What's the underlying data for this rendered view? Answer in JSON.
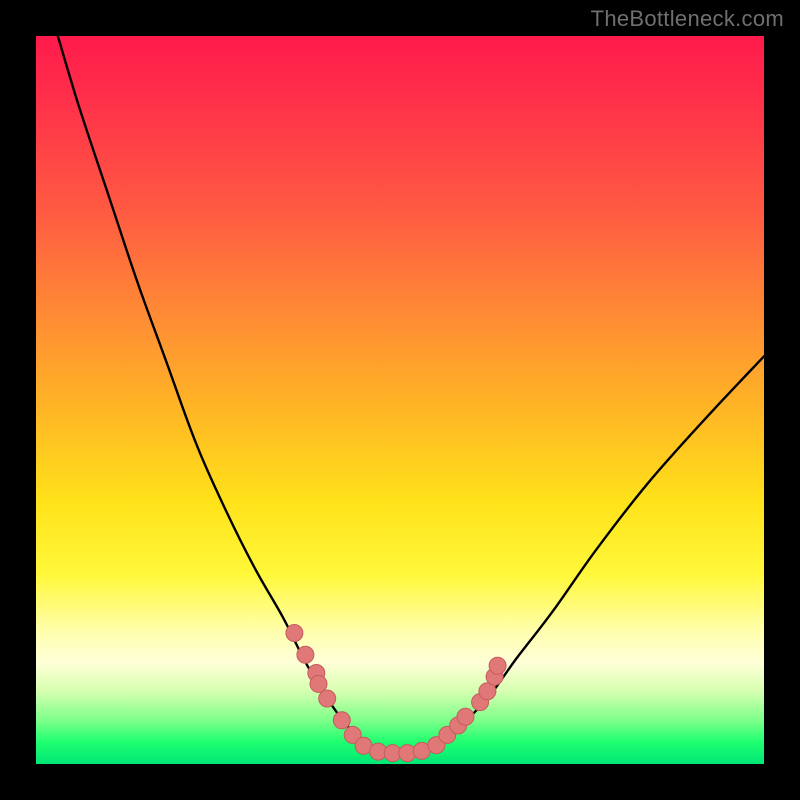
{
  "watermark": "TheBottleneck.com",
  "colors": {
    "frame": "#000000",
    "curve": "#000000",
    "dot_fill": "#e07878",
    "dot_stroke": "#c55c5c"
  },
  "chart_data": {
    "type": "line",
    "title": "",
    "xlabel": "",
    "ylabel": "",
    "xlim": [
      0,
      100
    ],
    "ylim": [
      0,
      100
    ],
    "note": "V-shaped bottleneck curve on vertical red→green gradient. Y is bottleneck severity (100=max red at top, 0=ideal green at bottom). X is component balance (GPU-limited left → CPU-limited right). Values estimated from pixel position since axes carry no tick labels.",
    "series": [
      {
        "name": "bottleneck-curve",
        "x": [
          3,
          6,
          10,
          14,
          18,
          22,
          26,
          30,
          34,
          37,
          40,
          43,
          46,
          49,
          52,
          55,
          58,
          62,
          66,
          71,
          77,
          84,
          92,
          100
        ],
        "y": [
          100,
          90,
          78,
          66,
          55,
          44,
          35,
          27,
          20,
          14,
          9,
          5,
          2.5,
          1.5,
          1.5,
          2.5,
          5,
          9,
          14.5,
          21,
          29.5,
          38.5,
          47.5,
          56
        ]
      }
    ],
    "dots": {
      "name": "sample-points",
      "x": [
        35.5,
        37,
        38.5,
        38.8,
        40,
        42,
        43.5,
        45,
        47,
        49,
        51,
        53,
        55,
        56.5,
        58,
        59,
        61,
        62,
        63,
        63.4
      ],
      "y": [
        18,
        15,
        12.5,
        11,
        9,
        6,
        4,
        2.5,
        1.7,
        1.5,
        1.5,
        1.8,
        2.6,
        4,
        5.3,
        6.5,
        8.5,
        10,
        12,
        13.5
      ]
    }
  }
}
